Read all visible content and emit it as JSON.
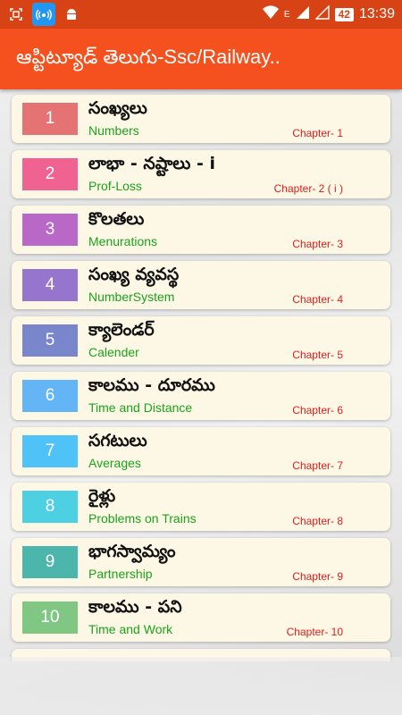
{
  "status_bar": {
    "battery_level": "42",
    "time": "13:39",
    "network_label": "E",
    "icons": [
      "screenshot-icon",
      "hotspot-icon",
      "android-icon",
      "wifi-icon",
      "signal-icon",
      "battery-icon"
    ]
  },
  "app_bar": {
    "title": "ఆప్టిట్యూడ్ తెలుగు-Ssc/Railway..",
    "color": "#f4511e"
  },
  "chapters": [
    {
      "number": "1",
      "title_te": "సంఖ్యలు",
      "title_en": "Numbers",
      "chapter": "Chapter- 1",
      "color": "#e57373"
    },
    {
      "number": "2",
      "title_te": "లాభా - నష్టాలు - i",
      "title_en": "Prof-Loss",
      "chapter": "Chapter- 2 ( i )",
      "color": "#f06292"
    },
    {
      "number": "3",
      "title_te": "కొలతలు",
      "title_en": "Menurations",
      "chapter": "Chapter- 3",
      "color": "#ba68c8"
    },
    {
      "number": "4",
      "title_te": "సంఖ్య వ్యవస్థ",
      "title_en": "NumberSystem",
      "chapter": "Chapter- 4",
      "color": "#9575cd"
    },
    {
      "number": "5",
      "title_te": "క్యాలెండర్",
      "title_en": "Calender",
      "chapter": "Chapter- 5",
      "color": "#7986cb"
    },
    {
      "number": "6",
      "title_te": "కాలము - దూరము",
      "title_en": "Time and Distance",
      "chapter": "Chapter- 6",
      "color": "#64b5f6"
    },
    {
      "number": "7",
      "title_te": "సగటులు",
      "title_en": "Averages",
      "chapter": "Chapter- 7",
      "color": "#4fc3f7"
    },
    {
      "number": "8",
      "title_te": "రైళ్లు",
      "title_en": "Problems on Trains",
      "chapter": "Chapter- 8",
      "color": "#4dd0e1"
    },
    {
      "number": "9",
      "title_te": "భాగస్వామ్యం",
      "title_en": "Partnership",
      "chapter": "Chapter- 9",
      "color": "#4db6ac"
    },
    {
      "number": "10",
      "title_te": "కాలము - పని",
      "title_en": "Time and Work",
      "chapter": "Chapter- 10",
      "color": "#81c784"
    }
  ]
}
